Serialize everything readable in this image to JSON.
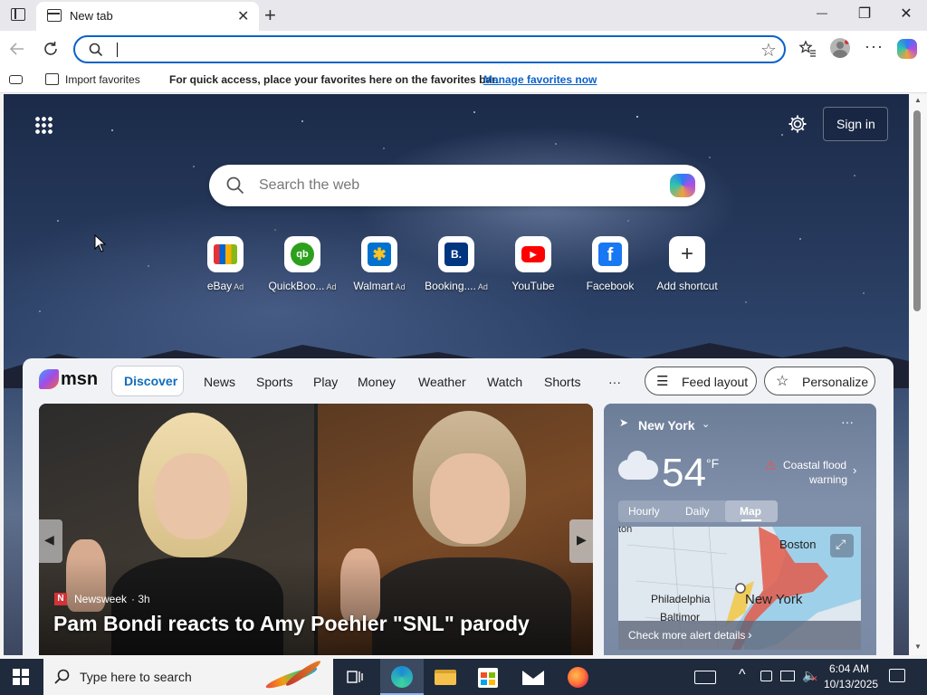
{
  "browser": {
    "tab_title": "New tab",
    "tab_close": "✕",
    "new_tab": "+",
    "window_controls": {
      "minimize": "—",
      "restore": "❐",
      "close": "✕"
    },
    "address_value": ""
  },
  "favorites_bar": {
    "import_label": "Import favorites",
    "message": "For quick access, place your favorites here on the favorites bar.",
    "manage_link": "Manage favorites now"
  },
  "newtab": {
    "sign_in": "Sign in",
    "search_placeholder": "Search the web",
    "shortcuts": [
      {
        "label": "eBay",
        "ad": "Ad",
        "glyph": ""
      },
      {
        "label": "QuickBoo...",
        "ad": "Ad",
        "glyph": "qb"
      },
      {
        "label": "Walmart",
        "ad": "Ad",
        "glyph": "✱"
      },
      {
        "label": "Booking....",
        "ad": "Ad",
        "glyph": "B."
      },
      {
        "label": "YouTube",
        "ad": "",
        "glyph": "▶"
      },
      {
        "label": "Facebook",
        "ad": "",
        "glyph": "f"
      },
      {
        "label": "Add shortcut",
        "ad": "",
        "glyph": "+"
      }
    ]
  },
  "msn": {
    "logo": "msn",
    "tabs": [
      "Discover",
      "News",
      "Sports",
      "Play",
      "Money",
      "Weather",
      "Watch",
      "Shorts"
    ],
    "more": "···",
    "feed_layout": "Feed layout",
    "personalize": "Personalize",
    "hero": {
      "source_badge": "N",
      "source": "Newsweek",
      "age": "· 3h",
      "headline": "Pam Bondi reacts to Amy Poehler \"SNL\" parody"
    },
    "weather": {
      "location": "New York",
      "more": "···",
      "temp": "54",
      "unit": "°F",
      "alert_line1": "Coastal flood",
      "alert_line2": "warning",
      "tabs": [
        "Hourly",
        "Daily",
        "Map"
      ],
      "active_tab": "Map",
      "map_labels": {
        "boston": "Boston",
        "philadelphia": "Philadelphia",
        "new_york": "New York",
        "baltimore": "Baltimor",
        "edge": "ton"
      },
      "alert_details": "Check more alert details"
    }
  },
  "taskbar": {
    "search_placeholder": "Type here to search",
    "time": "6:04 AM",
    "date": "10/13/2025"
  },
  "colors": {
    "accent": "#0b62c9",
    "msn_discover": "#0f6cbd",
    "alert_red": "#d13438",
    "taskbar": "#1f2a3c"
  }
}
